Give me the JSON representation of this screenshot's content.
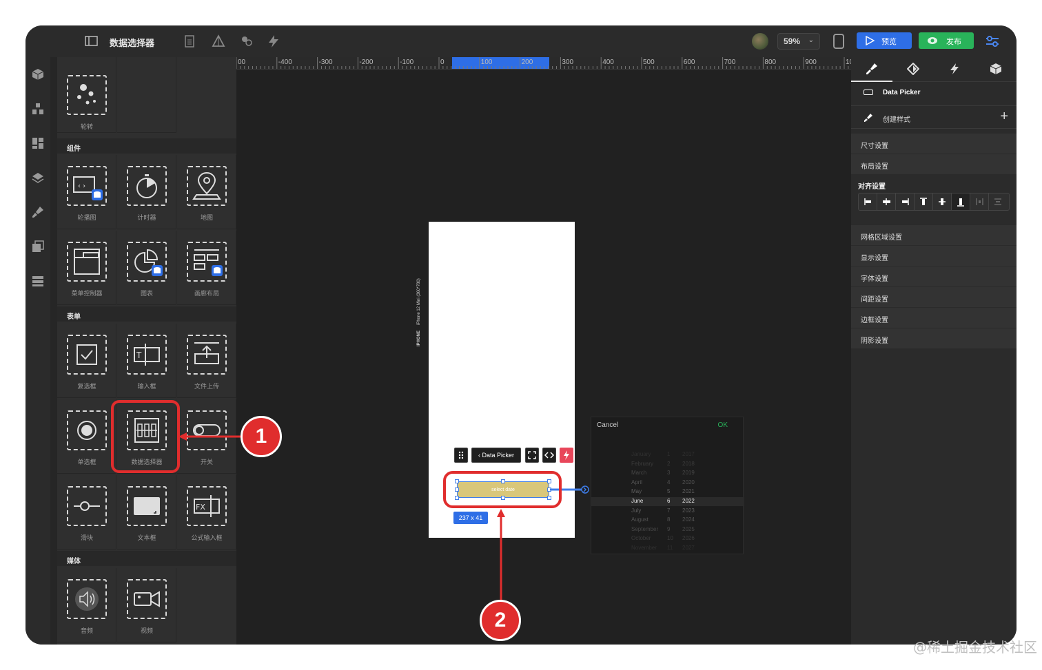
{
  "header": {
    "title": "数据选择器",
    "zoom": "59%",
    "preview_label": "预览",
    "publish_label": "发布"
  },
  "panel": {
    "top_item": "轮转",
    "sections": [
      {
        "title": "组件",
        "items": [
          "轮播图",
          "计时器",
          "地图",
          "菜单控制器",
          "图表",
          "画廊布局"
        ]
      },
      {
        "title": "表单",
        "items": [
          "复选框",
          "输入框",
          "文件上传",
          "单选框",
          "数据选择器",
          "开关",
          "滑块",
          "文本框",
          "公式输入框"
        ]
      },
      {
        "title": "媒体",
        "items": [
          "音频",
          "视频"
        ]
      }
    ]
  },
  "ruler": {
    "ticks": [
      "00",
      "-400",
      "-300",
      "-200",
      "-100",
      "0",
      "100",
      "200",
      "300",
      "400",
      "500",
      "600",
      "700",
      "800",
      "900",
      "100("
    ]
  },
  "canvas": {
    "device_label": "IPHONE",
    "device_model": "iPhone 12 Mini (360*780)",
    "toolbar_component": "Data Picker",
    "picker_placeholder": "select date",
    "size_badge": "237 x 41"
  },
  "dropdown_preview": {
    "cancel": "Cancel",
    "ok": "OK",
    "rows": [
      {
        "month": "January",
        "day": "1",
        "year": "2017"
      },
      {
        "month": "February",
        "day": "2",
        "year": "2018"
      },
      {
        "month": "March",
        "day": "3",
        "year": "2019"
      },
      {
        "month": "April",
        "day": "4",
        "year": "2020"
      },
      {
        "month": "May",
        "day": "5",
        "year": "2021"
      },
      {
        "month": "June",
        "day": "6",
        "year": "2022"
      },
      {
        "month": "July",
        "day": "7",
        "year": "2023"
      },
      {
        "month": "August",
        "day": "8",
        "year": "2024"
      },
      {
        "month": "September",
        "day": "9",
        "year": "2025"
      },
      {
        "month": "October",
        "day": "10",
        "year": "2026"
      },
      {
        "month": "November",
        "day": "11",
        "year": "2027"
      }
    ],
    "selected_index": 5
  },
  "props": {
    "component_name": "Data Picker",
    "create_style": "创建样式",
    "rows_a": [
      "尺寸设置",
      "布局设置"
    ],
    "align_title": "对齐设置",
    "rows_b": [
      "网格区域设置",
      "显示设置",
      "字体设置",
      "间距设置",
      "边框设置",
      "阴影设置"
    ]
  },
  "annotations": {
    "marker_1": "1",
    "marker_2": "2"
  },
  "watermark": "@稀土掘金技术社区",
  "colors": {
    "accent_blue": "#2e6ee6",
    "publish_green": "#29b35a",
    "annotation_red": "#e02d2d",
    "picker_fill": "#d9c77a"
  }
}
